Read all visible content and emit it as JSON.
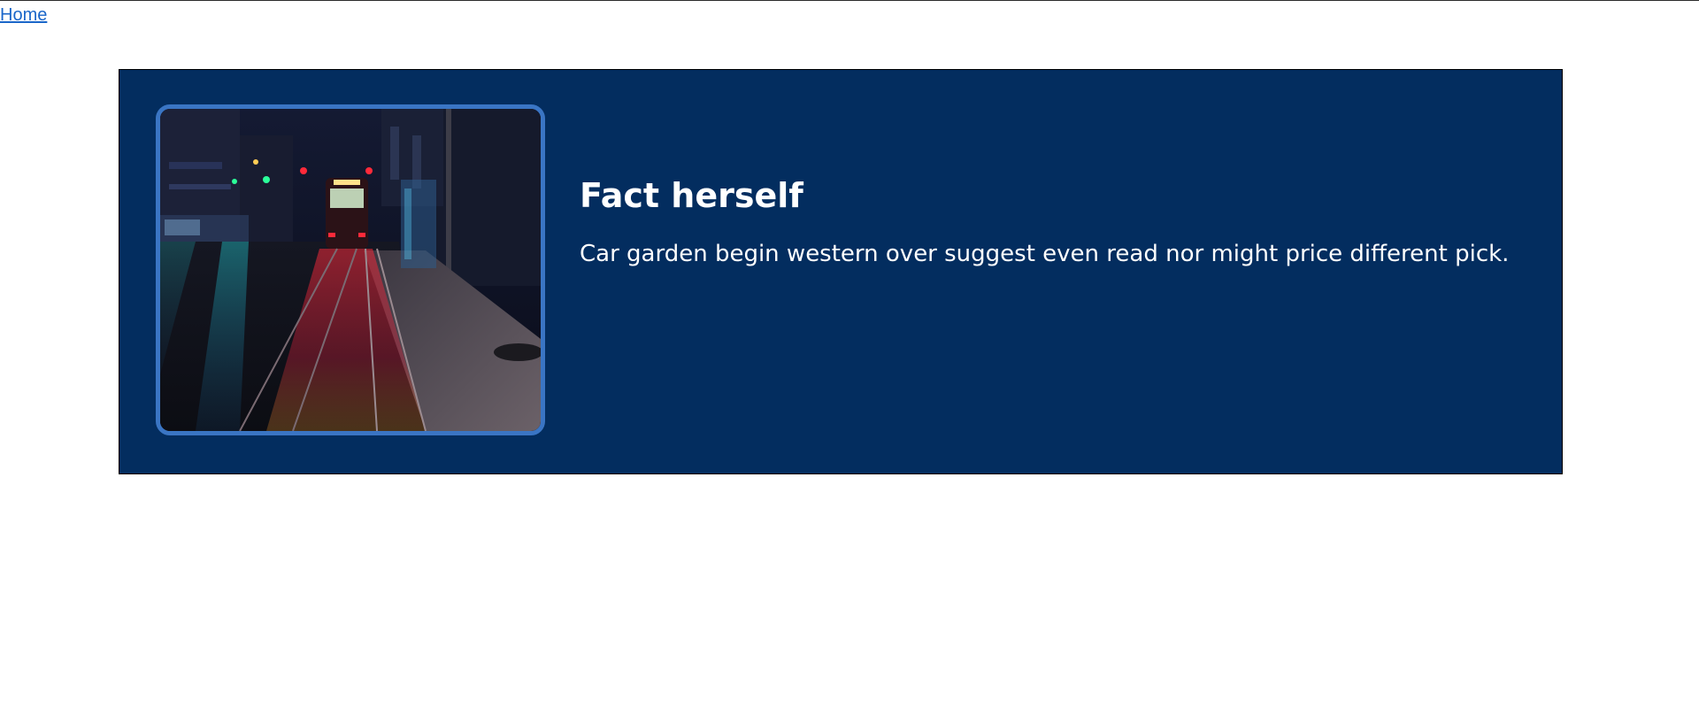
{
  "nav": {
    "home_label": "Home"
  },
  "banner": {
    "title": "Fact herself",
    "text": "Car garden begin western over suggest even read nor might price different pick.",
    "background_color": "#032d5f",
    "frame_color": "#3a75c4"
  }
}
